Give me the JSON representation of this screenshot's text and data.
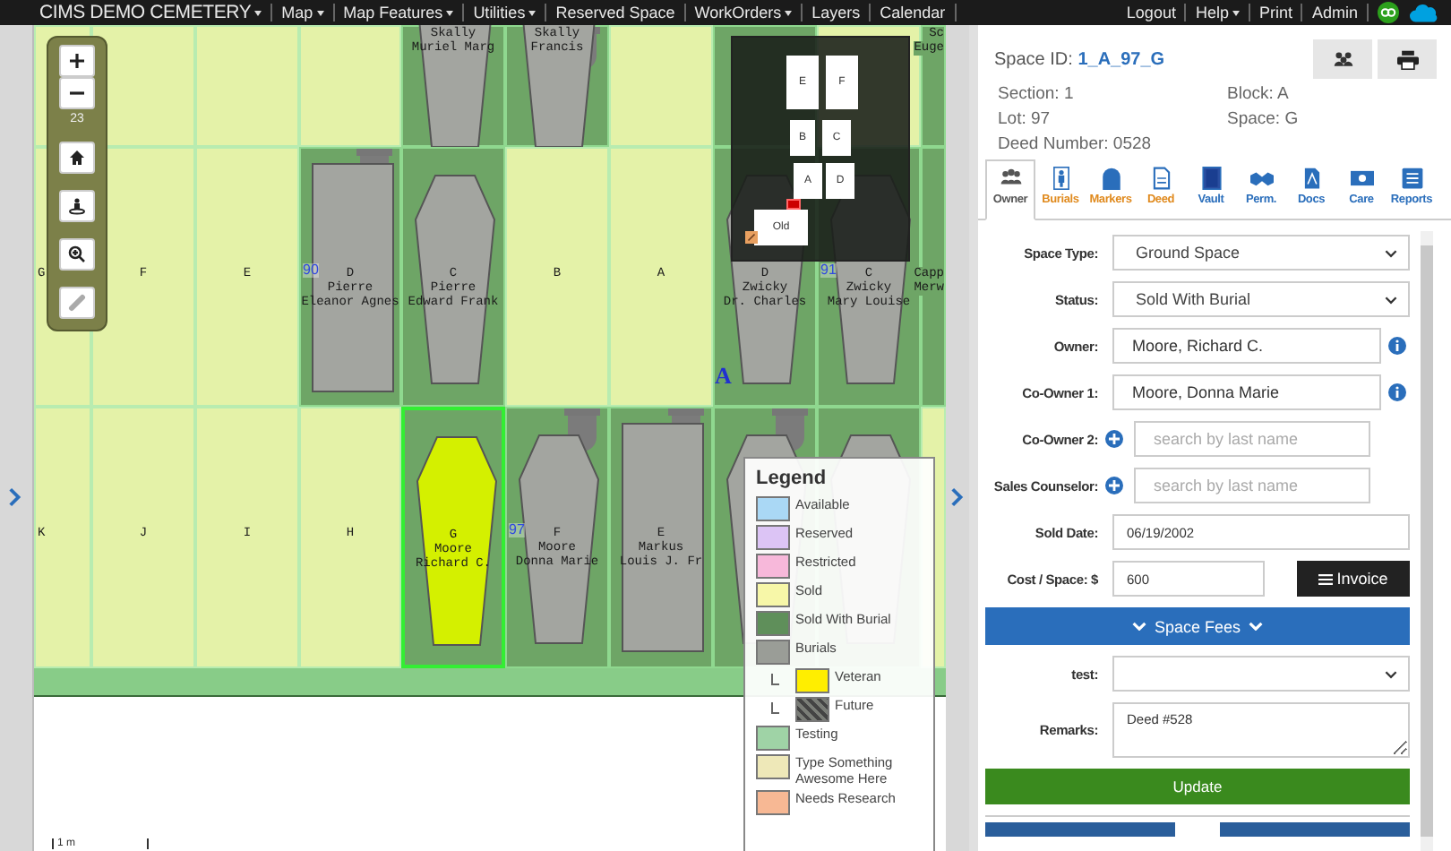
{
  "nav": {
    "brand": {
      "label": "CIMS DEMO CEMETERY",
      "dropdown": true
    },
    "items": [
      {
        "label": "Map",
        "dropdown": true
      },
      {
        "label": "Map Features",
        "dropdown": true
      },
      {
        "label": "Utilities",
        "dropdown": true
      },
      {
        "label": "Reserved Space",
        "dropdown": false
      },
      {
        "label": "WorkOrders",
        "dropdown": true
      },
      {
        "label": "Layers",
        "dropdown": false
      },
      {
        "label": "Calendar",
        "dropdown": false
      }
    ],
    "right_items": [
      {
        "label": "Logout",
        "dropdown": false
      },
      {
        "label": "Help",
        "dropdown": true
      },
      {
        "label": "Print",
        "dropdown": false
      },
      {
        "label": "Admin",
        "dropdown": false
      }
    ]
  },
  "map": {
    "zoom_level": "23",
    "section_label": "A",
    "scale_label": "1 m",
    "rows": [
      {
        "cells": [
          {
            "kind": "sold",
            "selected": false
          },
          {
            "kind": "sold",
            "selected": false
          },
          {
            "kind": "sold",
            "selected": false
          },
          {
            "kind": "sold",
            "selected": false
          },
          {
            "kind": "coffin",
            "selected": false,
            "names": [
              "Skally",
              "Muriel Marg"
            ]
          },
          {
            "kind": "coffin",
            "selected": false,
            "marker": true,
            "names": [
              "Skally",
              "Francis"
            ]
          },
          {
            "kind": "sold",
            "selected": false
          },
          {
            "kind": "burial",
            "selected": false
          },
          {
            "kind": "sold",
            "selected": false
          },
          {
            "kind": "burial",
            "selected": false,
            "names": [
              "Sc",
              "Euge"
            ]
          }
        ]
      },
      {
        "cells": [
          {
            "kind": "sold",
            "selected": false,
            "letter": "G"
          },
          {
            "kind": "sold",
            "selected": false,
            "letter": "F"
          },
          {
            "kind": "sold",
            "selected": false,
            "letter": "E"
          },
          {
            "kind": "vault",
            "selected": false,
            "marker": true,
            "letter": "D",
            "lot": "90",
            "names": [
              "Pierre",
              "Eleanor Agnes"
            ]
          },
          {
            "kind": "coffin",
            "selected": false,
            "letter": "C",
            "names": [
              "Pierre",
              "Edward Frank"
            ]
          },
          {
            "kind": "sold",
            "selected": false,
            "letter": "B"
          },
          {
            "kind": "sold",
            "selected": false,
            "letter": "A"
          },
          {
            "kind": "coffin",
            "selected": false,
            "letter": "D",
            "names": [
              "Zwicky",
              "Dr. Charles"
            ]
          },
          {
            "kind": "coffin",
            "selected": false,
            "letter": "C",
            "lot": "91",
            "names": [
              "Zwicky",
              "Mary Louise"
            ]
          },
          {
            "kind": "burial",
            "selected": false,
            "names": [
              "Capp",
              "Merw"
            ]
          }
        ]
      },
      {
        "cells": [
          {
            "kind": "sold",
            "selected": false,
            "letter": "K"
          },
          {
            "kind": "sold",
            "selected": false,
            "letter": "J"
          },
          {
            "kind": "sold",
            "selected": false,
            "letter": "I"
          },
          {
            "kind": "sold",
            "selected": false,
            "letter": "H"
          },
          {
            "kind": "veteran-coffin",
            "selected": true,
            "letter": "G",
            "names": [
              "Moore",
              "Richard C."
            ]
          },
          {
            "kind": "coffin",
            "selected": false,
            "marker": true,
            "letter": "F",
            "lot": "97",
            "names": [
              "Moore",
              "Donna Marie"
            ]
          },
          {
            "kind": "vault",
            "selected": false,
            "marker": true,
            "letter": "E",
            "names": [
              "Markus",
              "Louis J. Fr"
            ]
          },
          {
            "kind": "coffin",
            "selected": false,
            "marker": true
          },
          {
            "kind": "coffin",
            "selected": false
          },
          {
            "kind": "sold",
            "selected": false
          }
        ]
      }
    ],
    "minimap": {
      "blocks": [
        "E",
        "F",
        "B",
        "C",
        "A",
        "D",
        "Old"
      ]
    },
    "legend": {
      "title": "Legend",
      "items": [
        {
          "label": "Available",
          "color": "#aad8f5",
          "kind": "solid"
        },
        {
          "label": "Reserved",
          "color": "#dcc4f5",
          "kind": "solid"
        },
        {
          "label": "Restricted",
          "color": "#f7b8da",
          "kind": "solid"
        },
        {
          "label": "Sold",
          "color": "#f7f7a8",
          "kind": "solid"
        },
        {
          "label": "Sold With Burial",
          "color": "#5f8f5a",
          "kind": "solid"
        },
        {
          "label": "Burials",
          "color": "#9a9d97",
          "kind": "solid",
          "children": [
            {
              "label": "Veteran",
              "color": "#ffee00",
              "kind": "solid"
            },
            {
              "label": "Future",
              "color": "#7a7d77",
              "kind": "hatched"
            }
          ]
        },
        {
          "label": "Testing",
          "color": "#9fd3a6",
          "kind": "solid"
        },
        {
          "label": "Type Something Awesome Here",
          "color": "#eee8b8",
          "kind": "solid"
        },
        {
          "label": "Needs Research",
          "color": "#f7b894",
          "kind": "solid"
        }
      ]
    }
  },
  "panel": {
    "space_id_label": "Space ID:",
    "space_id": "1_A_97_G",
    "info": [
      {
        "label": "Section:",
        "value": "1"
      },
      {
        "label": "Block:",
        "value": "A"
      },
      {
        "label": "Lot:",
        "value": "97"
      },
      {
        "label": "Space:",
        "value": "G"
      },
      {
        "label": "Deed Number:",
        "value": "0528"
      }
    ],
    "tabs": [
      {
        "label": "Owner",
        "selected": true,
        "color": "#555555"
      },
      {
        "label": "Burials",
        "selected": false,
        "color": "#e08a1e"
      },
      {
        "label": "Markers",
        "selected": false,
        "color": "#e08a1e"
      },
      {
        "label": "Deed",
        "selected": false,
        "color": "#e08a1e"
      },
      {
        "label": "Vault",
        "selected": false,
        "color": "#2a6ebb"
      },
      {
        "label": "Perm.",
        "selected": false,
        "color": "#2a6ebb"
      },
      {
        "label": "Docs",
        "selected": false,
        "color": "#2a6ebb"
      },
      {
        "label": "Care",
        "selected": false,
        "color": "#2a6ebb"
      },
      {
        "label": "Reports",
        "selected": false,
        "color": "#2a6ebb"
      }
    ],
    "fields": [
      {
        "label": "Space Type:",
        "kind": "select",
        "value": "Ground Space"
      },
      {
        "label": "Status:",
        "kind": "select",
        "value": "Sold With Burial"
      },
      {
        "label": "Owner:",
        "kind": "text-info",
        "value": "Moore, Richard C."
      },
      {
        "label": "Co-Owner 1:",
        "kind": "text-info",
        "value": "Moore, Donna Marie"
      },
      {
        "label": "Co-Owner 2:",
        "kind": "search-add",
        "placeholder": "search by last name"
      },
      {
        "label": "Sales Counselor:",
        "kind": "search-add",
        "placeholder": "search by last name"
      },
      {
        "label": "Sold Date:",
        "kind": "text",
        "value": "06/19/2002"
      },
      {
        "label": "Cost / Space: $",
        "kind": "cost",
        "value": "600",
        "button": "Invoice"
      },
      {
        "label": "Space Fees",
        "kind": "section"
      },
      {
        "label": "test:",
        "kind": "select"
      },
      {
        "label": "Remarks:",
        "kind": "textarea",
        "value": "Deed #528"
      }
    ],
    "update_button": "Update"
  }
}
